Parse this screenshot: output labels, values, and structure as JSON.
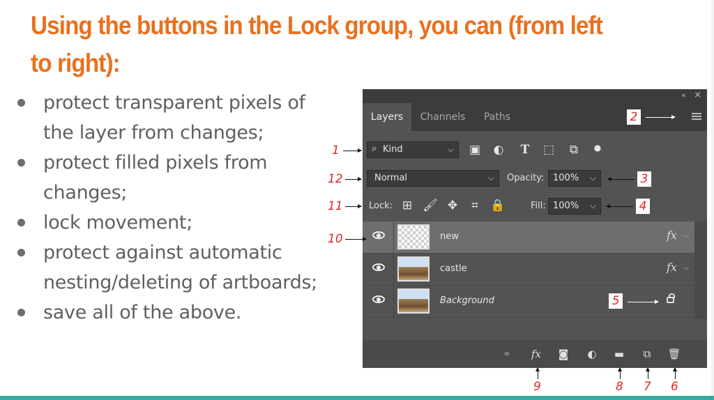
{
  "slide": {
    "title": "Using the buttons in the Lock group, you can (from left to right):",
    "bullets": [
      "protect transparent pixels of the layer from changes;",
      "protect filled pixels from changes;",
      "lock movement;",
      "protect against automatic nesting/deleting of artboards;",
      "save all of the above."
    ],
    "accent_color": "#e8711f",
    "bar_color": "#3aa9a3"
  },
  "panel": {
    "collapse_icon": "«",
    "close_icon": "×",
    "tabs": [
      "Layers",
      "Channels",
      "Paths"
    ],
    "active_tab": "Layers",
    "filter": {
      "value": "Kind",
      "icon": "search-icon"
    },
    "filter_icons": [
      "image-filter-icon",
      "adjustment-filter-icon",
      "type-filter-icon",
      "shape-filter-icon",
      "smart-object-filter-icon",
      "filter-toggle-icon"
    ],
    "blend_mode": "Normal",
    "opacity_label": "Opacity:",
    "opacity_value": "100%",
    "lock_label": "Lock:",
    "lock_icons": [
      "lock-transparent-pixels-icon",
      "lock-image-pixels-icon",
      "lock-position-icon",
      "lock-artboard-icon",
      "lock-all-icon"
    ],
    "fill_label": "Fill:",
    "fill_value": "100%",
    "layers": [
      {
        "name": "new",
        "thumb": "transparent",
        "fx": "fx",
        "selected": true
      },
      {
        "name": "castle",
        "thumb": "photo",
        "fx": "fx",
        "selected": false
      },
      {
        "name": "Background",
        "thumb": "photo",
        "locked": true,
        "selected": false
      }
    ],
    "bottom_icons": [
      "link-icon",
      "fx-icon",
      "mask-icon",
      "adjustment-icon",
      "folder-icon",
      "new-layer-icon",
      "trash-icon"
    ],
    "fx_text": "fx"
  },
  "annotations": {
    "n1": "1",
    "n2": "2",
    "n3": "3",
    "n4": "4",
    "n5": "5",
    "n6": "6",
    "n7": "7",
    "n8": "8",
    "n9": "9",
    "n10": "10",
    "n11": "11",
    "n12": "12"
  }
}
